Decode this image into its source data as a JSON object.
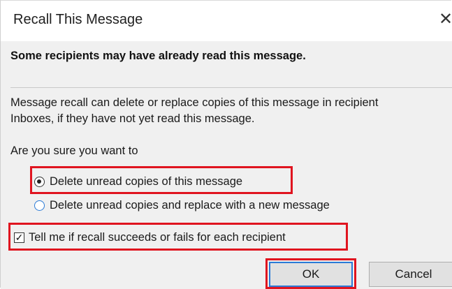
{
  "dialog": {
    "title": "Recall This Message",
    "close_glyph": "✕",
    "warning": "Some recipients may have already read this message.",
    "description": "Message recall can delete or replace copies of this message in recipient\nInboxes, if they have not yet read this message.",
    "question": "Are you sure you want to",
    "options": [
      {
        "label": "Delete unread copies of this message",
        "selected": true
      },
      {
        "label": "Delete unread copies and replace with a new message",
        "selected": false
      }
    ],
    "checkbox": {
      "label": "Tell me if recall succeeds or fails for each recipient",
      "checked": true,
      "glyph": "✓"
    },
    "buttons": {
      "ok": "OK",
      "cancel": "Cancel"
    }
  },
  "colors": {
    "highlight": "#e0141f",
    "focus": "#2a7ad6",
    "body_bg": "#f0f0f0"
  }
}
